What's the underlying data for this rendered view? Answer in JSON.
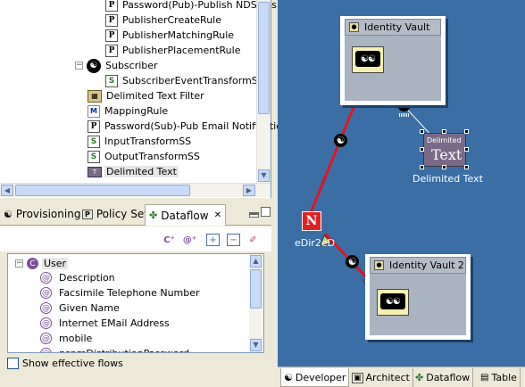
{
  "tree": {
    "items": [
      {
        "label": "Password(Pub)-Publish NDS Pas",
        "icon": "policy-icon"
      },
      {
        "label": "PublisherCreateRule",
        "icon": "policy-icon"
      },
      {
        "label": "PublisherMatchingRule",
        "icon": "policy-icon"
      },
      {
        "label": "PublisherPlacementRule",
        "icon": "policy-icon"
      },
      {
        "label": "Subscriber",
        "icon": "subscriber-icon",
        "expander": "−"
      },
      {
        "label": "SubscriberEventTransformSS",
        "icon": "stylesheet-icon"
      },
      {
        "label": "Delimited Text Filter",
        "icon": "filter-icon"
      },
      {
        "label": "MappingRule",
        "icon": "mapping-icon"
      },
      {
        "label": "Password(Sub)-Pub Email Notificatio",
        "icon": "policy-icon"
      },
      {
        "label": "InputTransformSS",
        "icon": "stylesheet-icon"
      },
      {
        "label": "OutputTransformSS",
        "icon": "stylesheet-icon"
      },
      {
        "label": "Delimited Text",
        "icon": "driver-icon"
      }
    ]
  },
  "tabs": {
    "provisioning": "Provisioning",
    "policy_set": "Policy Set",
    "dataflow": "Dataflow",
    "close_glyph": "✕"
  },
  "dataflow": {
    "toolbar_icons": [
      "add-class-icon",
      "add-attribute-icon",
      "expand-all-icon",
      "collapse-all-icon",
      "clear-icon"
    ],
    "root": {
      "label": "User",
      "expander": "−"
    },
    "attributes": [
      "Description",
      "Facsimile Telephone Number",
      "Given Name",
      "Internet EMail Address",
      "mobile",
      "nspmDistributionPassword"
    ],
    "show_effective_flows": "Show effective flows"
  },
  "canvas": {
    "vault1_title": "Identity Vault",
    "vault2_title": "Identity Vault 2",
    "driver_label": "Delimited Text",
    "driver_icon_text": "Text",
    "driver_icon_caption": "Delimited",
    "edir_label": "eDir2eD",
    "edir_glyph": "N"
  },
  "bottom_tabs": [
    "Developer",
    "Architect",
    "Dataflow",
    "Table"
  ],
  "colors": {
    "canvas_bg": "#3a6ea5",
    "flow_line": "#e0141e",
    "arrow_fill": "#c8d07a"
  }
}
